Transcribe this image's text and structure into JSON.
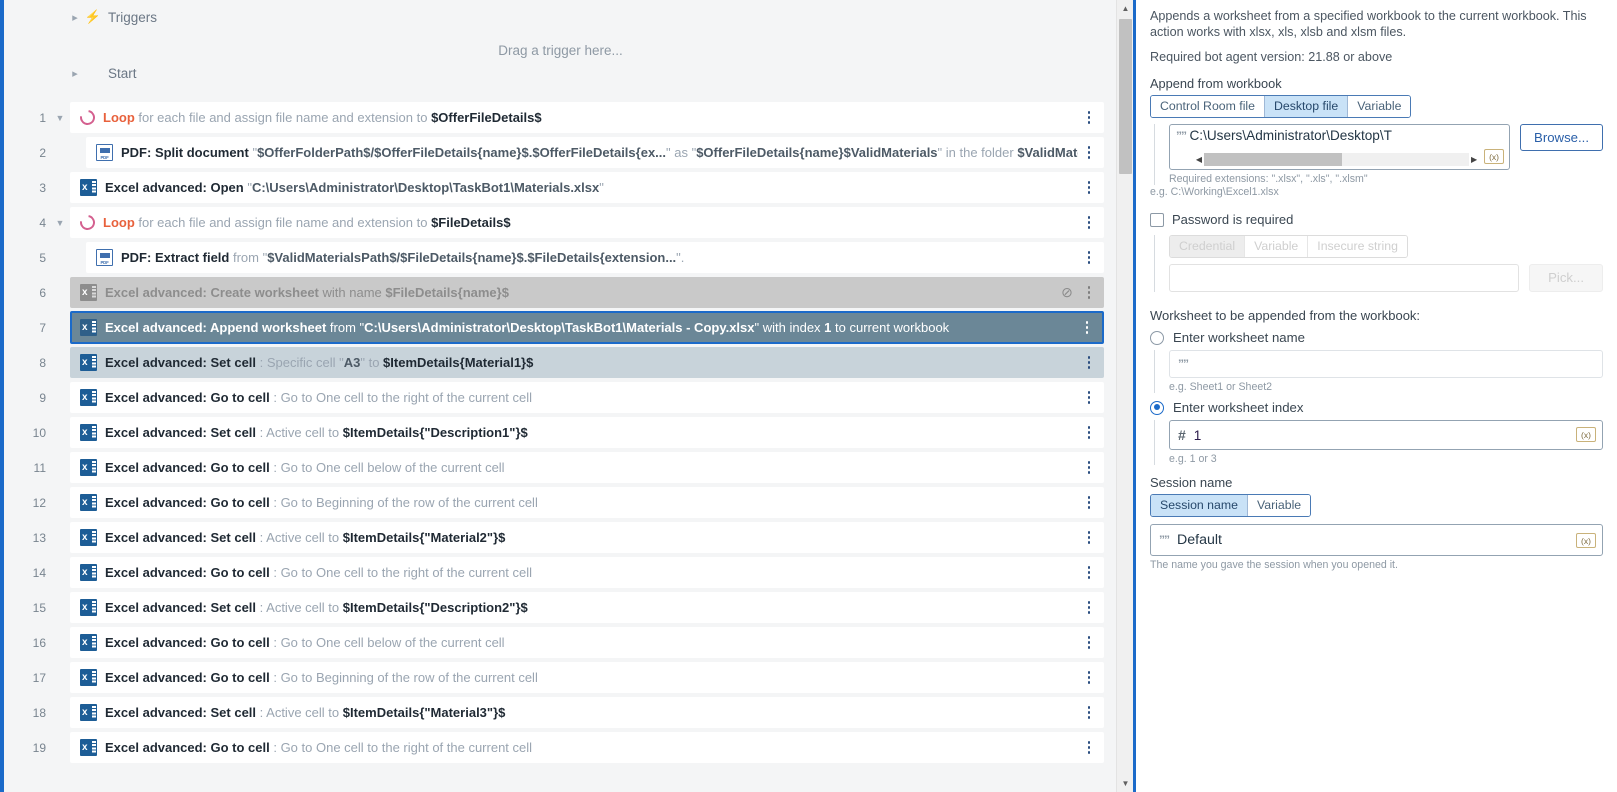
{
  "flow": {
    "triggers_label": "Triggers",
    "drag_hint": "Drag a trigger here...",
    "start_label": "Start",
    "rows": [
      {
        "num": "1",
        "indent": 0,
        "icon": "loop-icon",
        "expander": true,
        "state": "normal",
        "segments": [
          {
            "t": "Loop",
            "c": "loopkw"
          },
          {
            "t": " for each file and assign file name and extension to ",
            "c": "dim"
          },
          {
            "t": "$OfferFileDetails$",
            "c": "b"
          }
        ]
      },
      {
        "num": "2",
        "indent": 1,
        "icon": "pdf-icon",
        "expander": false,
        "state": "normal",
        "segments": [
          {
            "t": "PDF: Split document",
            "c": "b"
          },
          {
            "t": " \"",
            "c": "dim"
          },
          {
            "t": "$OfferFolderPath$/$OfferFileDetails{name}$.$OfferFileDetails{ex...",
            "c": "lit"
          },
          {
            "t": "\" as \"",
            "c": "dim"
          },
          {
            "t": "$OfferFileDetails{name}$ValidMaterials",
            "c": "lit"
          },
          {
            "t": "\" in the folder ",
            "c": "dim"
          },
          {
            "t": "$ValidMaterial...",
            "c": "lit"
          }
        ]
      },
      {
        "num": "3",
        "indent": 0,
        "icon": "excel-icon",
        "expander": false,
        "state": "normal",
        "segments": [
          {
            "t": "Excel advanced: Open",
            "c": "b"
          },
          {
            "t": " \"",
            "c": "dim"
          },
          {
            "t": "C:\\Users\\Administrator\\Desktop\\TaskBot1\\Materials.xlsx",
            "c": "lit"
          },
          {
            "t": "\"",
            "c": "dim"
          }
        ]
      },
      {
        "num": "4",
        "indent": 0,
        "icon": "loop-icon",
        "expander": true,
        "state": "normal",
        "segments": [
          {
            "t": "Loop",
            "c": "loopkw"
          },
          {
            "t": " for each file and assign file name and extension to ",
            "c": "dim"
          },
          {
            "t": "$FileDetails$",
            "c": "b"
          }
        ]
      },
      {
        "num": "5",
        "indent": 1,
        "icon": "pdf-icon",
        "expander": false,
        "state": "normal",
        "segments": [
          {
            "t": "PDF: Extract field",
            "c": "b"
          },
          {
            "t": " from \"",
            "c": "dim"
          },
          {
            "t": "$ValidMaterialsPath$/$FileDetails{name}$.$FileDetails{extension...",
            "c": "lit"
          },
          {
            "t": "\".",
            "c": "dim"
          }
        ]
      },
      {
        "num": "6",
        "indent": 0,
        "icon": "excel-icon",
        "expander": false,
        "state": "disabled",
        "badge": "disabled-icon",
        "segments": [
          {
            "t": "Excel advanced: Create worksheet",
            "c": "b"
          },
          {
            "t": " with name ",
            "c": "dim"
          },
          {
            "t": "$FileDetails{name}$",
            "c": "b"
          }
        ]
      },
      {
        "num": "7",
        "indent": 0,
        "icon": "excel-icon",
        "expander": false,
        "state": "selected",
        "segments": [
          {
            "t": "Excel advanced: Append worksheet",
            "c": "b"
          },
          {
            "t": " from \"",
            "c": "dim"
          },
          {
            "t": "C:\\Users\\Administrator\\Desktop\\TaskBot1\\Materials - Copy.xlsx",
            "c": "lit"
          },
          {
            "t": "\" with index ",
            "c": "dim"
          },
          {
            "t": "1",
            "c": "b"
          },
          {
            "t": " to current workbook",
            "c": "dim"
          }
        ]
      },
      {
        "num": "8",
        "indent": 0,
        "icon": "excel-icon",
        "expander": false,
        "state": "subsel",
        "segments": [
          {
            "t": "Excel advanced: Set cell",
            "c": "b"
          },
          {
            "t": " : Specific cell \"",
            "c": "dim"
          },
          {
            "t": "A3",
            "c": "lit"
          },
          {
            "t": "\" to ",
            "c": "dim"
          },
          {
            "t": "$ItemDetails{Material1}$",
            "c": "b"
          }
        ]
      },
      {
        "num": "9",
        "indent": 0,
        "icon": "excel-icon",
        "expander": false,
        "state": "normal",
        "segments": [
          {
            "t": "Excel advanced: Go to cell",
            "c": "b"
          },
          {
            "t": " : Go to One cell to the right of the current cell",
            "c": "dim"
          }
        ]
      },
      {
        "num": "10",
        "indent": 0,
        "icon": "excel-icon",
        "expander": false,
        "state": "normal",
        "segments": [
          {
            "t": "Excel advanced: Set cell",
            "c": "b"
          },
          {
            "t": " : Active cell to ",
            "c": "dim"
          },
          {
            "t": "$ItemDetails{\"Description1\"}$",
            "c": "b"
          }
        ]
      },
      {
        "num": "11",
        "indent": 0,
        "icon": "excel-icon",
        "expander": false,
        "state": "normal",
        "segments": [
          {
            "t": "Excel advanced: Go to cell",
            "c": "b"
          },
          {
            "t": " : Go to One cell below of the current cell",
            "c": "dim"
          }
        ]
      },
      {
        "num": "12",
        "indent": 0,
        "icon": "excel-icon",
        "expander": false,
        "state": "normal",
        "segments": [
          {
            "t": "Excel advanced: Go to cell",
            "c": "b"
          },
          {
            "t": " : Go to Beginning of the row of the current cell",
            "c": "dim"
          }
        ]
      },
      {
        "num": "13",
        "indent": 0,
        "icon": "excel-icon",
        "expander": false,
        "state": "normal",
        "segments": [
          {
            "t": "Excel advanced: Set cell",
            "c": "b"
          },
          {
            "t": " : Active cell to ",
            "c": "dim"
          },
          {
            "t": "$ItemDetails{\"Material2\"}$",
            "c": "b"
          }
        ]
      },
      {
        "num": "14",
        "indent": 0,
        "icon": "excel-icon",
        "expander": false,
        "state": "normal",
        "segments": [
          {
            "t": "Excel advanced: Go to cell",
            "c": "b"
          },
          {
            "t": " : Go to One cell to the right of the current cell",
            "c": "dim"
          }
        ]
      },
      {
        "num": "15",
        "indent": 0,
        "icon": "excel-icon",
        "expander": false,
        "state": "normal",
        "segments": [
          {
            "t": "Excel advanced: Set cell",
            "c": "b"
          },
          {
            "t": " : Active cell to ",
            "c": "dim"
          },
          {
            "t": "$ItemDetails{\"Description2\"}$",
            "c": "b"
          }
        ]
      },
      {
        "num": "16",
        "indent": 0,
        "icon": "excel-icon",
        "expander": false,
        "state": "normal",
        "segments": [
          {
            "t": "Excel advanced: Go to cell",
            "c": "b"
          },
          {
            "t": " : Go to One cell below of the current cell",
            "c": "dim"
          }
        ]
      },
      {
        "num": "17",
        "indent": 0,
        "icon": "excel-icon",
        "expander": false,
        "state": "normal",
        "segments": [
          {
            "t": "Excel advanced: Go to cell",
            "c": "b"
          },
          {
            "t": " : Go to Beginning of the row of the current cell",
            "c": "dim"
          }
        ]
      },
      {
        "num": "18",
        "indent": 0,
        "icon": "excel-icon",
        "expander": false,
        "state": "normal",
        "segments": [
          {
            "t": "Excel advanced: Set cell",
            "c": "b"
          },
          {
            "t": " : Active cell to ",
            "c": "dim"
          },
          {
            "t": "$ItemDetails{\"Material3\"}$",
            "c": "b"
          }
        ]
      },
      {
        "num": "19",
        "indent": 0,
        "icon": "excel-icon",
        "expander": false,
        "state": "normal",
        "segments": [
          {
            "t": "Excel advanced: Go to cell",
            "c": "b"
          },
          {
            "t": " : Go to One cell to the right of the current cell",
            "c": "dim"
          }
        ]
      }
    ]
  },
  "props": {
    "description": "Appends a worksheet from a specified workbook to the current workbook. This action works with xlsx, xls, xlsb and xlsm files.",
    "required_version": "Required bot agent version: 21.88 or above",
    "append_from_label": "Append from workbook",
    "source_tabs": [
      "Control Room file",
      "Desktop file",
      "Variable"
    ],
    "source_tab_selected": "Desktop file",
    "file_path_value": "C:\\Users\\Administrator\\Desktop\\T",
    "browse_label": "Browse...",
    "required_extensions": "Required extensions: \".xlsx\", \".xls\", \".xlsm\"",
    "path_example": "e.g. C:\\Working\\Excel1.xlsx",
    "password_label": "Password is required",
    "password_tabs": [
      "Credential",
      "Variable",
      "Insecure string"
    ],
    "password_tab_selected": "Credential",
    "pick_label": "Pick...",
    "worksheet_section_label": "Worksheet to be appended from the workbook:",
    "radio_name_label": "Enter worksheet name",
    "worksheet_name_value": "",
    "worksheet_name_hint": "e.g. Sheet1 or Sheet2",
    "radio_index_label": "Enter worksheet index",
    "worksheet_index_value": "1",
    "worksheet_index_hint": "e.g. 1 or 3",
    "session_label": "Session name",
    "session_tabs": [
      "Session name",
      "Variable"
    ],
    "session_tab_selected": "Session name",
    "session_value": "Default",
    "session_hint": "The name you gave the session when you opened it.",
    "fx_label": "(x)"
  }
}
